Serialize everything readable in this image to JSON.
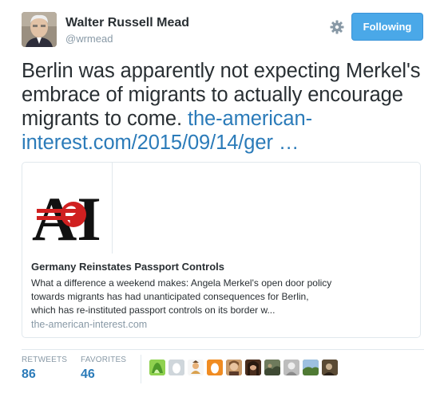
{
  "user": {
    "name": "Walter Russell Mead",
    "handle": "@wrmead",
    "avatar_icon": "user-avatar"
  },
  "actions": {
    "settings_icon": "gear-icon",
    "follow_label": "Following"
  },
  "tweet": {
    "text": "Berlin was apparently not expecting Merkel's embrace of migrants to actually encourage migrants to come.",
    "link_text": "the-american-interest.com/2015/09/14/ger …"
  },
  "card": {
    "logo_text": "AI",
    "title": "Germany Reinstates Passport Controls",
    "description": "What a difference a weekend makes: Angela Merkel's open door policy towards migrants has had unanticipated consequences for Berlin, which has re-instituted passport controls on its border w...",
    "domain": "the-american-interest.com"
  },
  "stats": {
    "retweets_label": "RETWEETS",
    "retweets_value": "86",
    "favorites_label": "FAVORITES",
    "favorites_value": "46"
  },
  "colors": {
    "link": "#2b7bb9",
    "button": "#4aa8e8",
    "muted": "#8899a6"
  }
}
